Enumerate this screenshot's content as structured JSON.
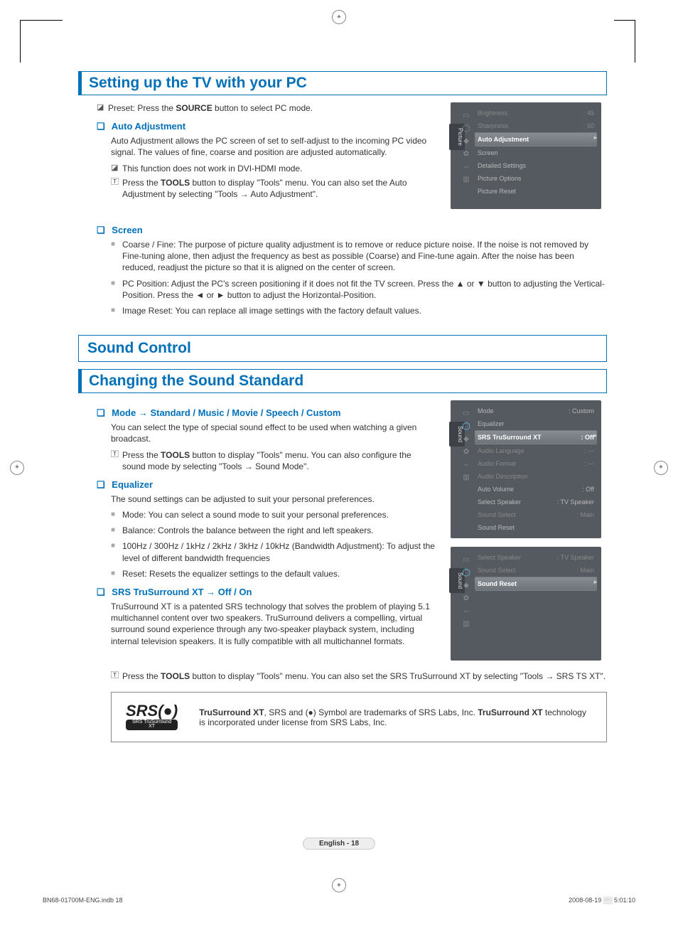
{
  "section1": {
    "title": "Setting up the TV with your PC",
    "preset_line_before": "Preset: Press the ",
    "preset_bold": "SOURCE",
    "preset_line_after": " button to select PC mode.",
    "auto_adj": {
      "heading": "Auto Adjustment",
      "body": "Auto Adjustment allows the PC screen of set to self-adjust to the incoming PC video signal. The values of fine, coarse and position are adjusted automatically.",
      "note1": "This function does not work in DVI-HDMI mode.",
      "note2_before": "Press the ",
      "note2_bold": "TOOLS",
      "note2_after": " button to display \"Tools\" menu. You can also set the Auto Adjustment by selecting \"Tools → Auto Adjustment\"."
    },
    "screen": {
      "heading": "Screen",
      "b1": "Coarse / Fine: The purpose of picture quality adjustment is to remove or reduce picture noise. If the noise is not removed by Fine-tuning alone, then adjust the frequency as best as possible (Coarse) and Fine-tune again. After the noise has been reduced, readjust the picture so that it is aligned on the center of screen.",
      "b2": "PC Position: Adjust the PC's screen positioning if it does not fit the TV screen. Press the ▲ or ▼ button to adjusting the Vertical-Position. Press the ◄ or ► button to adjust the Horizontal-Position.",
      "b3": "Image Reset: You can replace all image settings with the factory default values."
    }
  },
  "section2_title": "Sound Control",
  "section3": {
    "title": "Changing the Sound Standard",
    "mode": {
      "heading": "Mode → Standard / Music / Movie / Speech / Custom",
      "body": "You can select the type of special sound effect to be used when watching a given broadcast.",
      "note_before": "Press the ",
      "note_bold": "TOOLS",
      "note_after": " button to display \"Tools\" menu. You can also configure the sound mode by selecting \"Tools → Sound Mode\"."
    },
    "eq": {
      "heading": "Equalizer",
      "body": "The sound settings can be adjusted to suit your personal preferences.",
      "b1": "Mode: You can select a sound mode to suit your personal preferences.",
      "b2": "Balance: Controls the balance between the right and left speakers.",
      "b3": "100Hz / 300Hz / 1kHz / 2kHz / 3kHz / 10kHz (Bandwidth Adjustment): To adjust the level of different bandwidth frequencies",
      "b4": "Reset: Resets the equalizer settings to the default values."
    },
    "srs": {
      "heading": "SRS TruSurround XT → Off / On",
      "body": "TruSurround XT is a patented SRS technology that solves the problem of playing 5.1 multichannel content over two speakers. TruSurround delivers a compelling, virtual surround sound experience through any two-speaker playback system, including internal television speakers. It is fully compatible with all multichannel formats.",
      "note_before": "Press the ",
      "note_bold": "TOOLS",
      "note_after": " button to display \"Tools\" menu. You can also set the SRS TruSurround XT by selecting \"Tools → SRS TS XT\"."
    }
  },
  "srs_box": {
    "logo_main": "SRS(●)",
    "logo_sub": "SRS TruSurround XT",
    "text_b1": "TruSurround XT",
    "text_mid1": ", SRS and ",
    "text_mid2": " Symbol are trademarks of SRS Labs, Inc. ",
    "text_b2": "TruSurround XT",
    "text_end": " technology is incorporated under license from SRS Labs, Inc."
  },
  "osd1": {
    "tab": "Picture",
    "rows": [
      {
        "l": "Brightness",
        "r": ": 45",
        "dim": true
      },
      {
        "l": "Sharpness",
        "r": ": 50",
        "dim": true
      },
      {
        "l": "Auto Adjustment",
        "r": "",
        "sel": true
      },
      {
        "l": "Screen",
        "r": ""
      },
      {
        "l": "Detailed Settings",
        "r": ""
      },
      {
        "l": "Picture Options",
        "r": ""
      },
      {
        "l": "Picture Reset",
        "r": ""
      }
    ]
  },
  "osd2": {
    "tab": "Sound",
    "rows": [
      {
        "l": "Mode",
        "r": ": Custom"
      },
      {
        "l": "Equalizer",
        "r": ""
      },
      {
        "l": "SRS TruSurround XT",
        "r": ": Off",
        "sel": true
      },
      {
        "l": "Audio Language",
        "r": ": ---",
        "dim": true
      },
      {
        "l": "Audio Format",
        "r": ": ---",
        "dim": true
      },
      {
        "l": "Audio Description",
        "r": "",
        "dim": true
      },
      {
        "l": "Auto Volume",
        "r": ": Off"
      },
      {
        "l": "Select Speaker",
        "r": ": TV Speaker"
      },
      {
        "l": "Sound Select",
        "r": ": Main",
        "dim": true
      },
      {
        "l": "Sound Reset",
        "r": ""
      }
    ]
  },
  "osd3": {
    "tab": "Sound",
    "rows": [
      {
        "l": "Select Speaker",
        "r": ": TV Speaker",
        "dim": true
      },
      {
        "l": "Sound Select",
        "r": ": Main",
        "dim": true
      },
      {
        "l": "Sound Reset",
        "r": "",
        "sel": true
      }
    ]
  },
  "footer": "English - 18",
  "print": {
    "file": "BN68-01700M-ENG.indb   18",
    "date": "2008-08-19   ░░ 5:01:10"
  }
}
